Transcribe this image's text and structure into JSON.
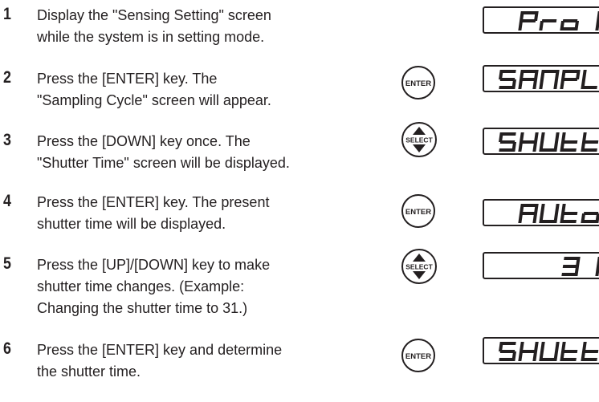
{
  "steps": [
    {
      "number": "1",
      "lines": [
        "Display the \"Sensing Setting\" screen",
        "while the system is in setting mode."
      ],
      "key": "",
      "display": "Pro1"
    },
    {
      "number": "2",
      "lines": [
        "Press the [ENTER] key. The",
        "\"Sampling Cycle\" screen will appear."
      ],
      "key": "ENTER",
      "display": "SAMPL"
    },
    {
      "number": "3",
      "lines": [
        "Press the [DOWN] key once. The",
        "\"Shutter Time\" screen will be displayed."
      ],
      "key": "SELECT",
      "display": "SHUtt"
    },
    {
      "number": "4",
      "lines": [
        "Press the [ENTER] key. The present",
        "shutter time will be displayed."
      ],
      "key": "ENTER",
      "display": "AUto"
    },
    {
      "number": "5",
      "lines": [
        "Press the [UP]/[DOWN] key to make",
        "shutter time changes. (Example:",
        "Changing the shutter time to 31.)"
      ],
      "key": "SELECT",
      "display": "31"
    },
    {
      "number": "6",
      "lines": [
        "Press the [ENTER] key and determine",
        "the shutter time."
      ],
      "key": "ENTER",
      "display": "SHUtt"
    }
  ],
  "icons": {
    "enter": "enter-key-icon",
    "select": "select-up-down-key-icon"
  },
  "colors": {
    "ink": "#231f20",
    "background": "#ffffff"
  }
}
